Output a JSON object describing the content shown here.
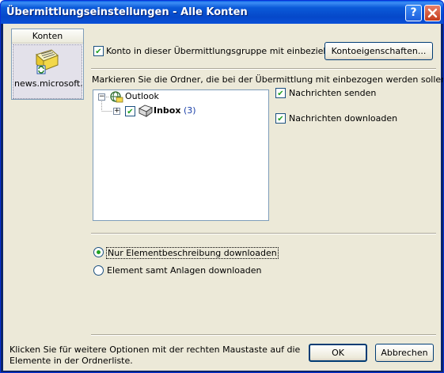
{
  "window": {
    "title": "Übermittlungseinstellungen - Alle Konten",
    "help_label": "?",
    "close_label": "✕"
  },
  "accounts": {
    "header": "Konten",
    "items": [
      {
        "name": "news.microsoft..."
      }
    ]
  },
  "include_account": {
    "label": "Konto in dieser Übermittlungsgruppe mit einbeziehen",
    "checked": true
  },
  "account_properties_button": "Kontoeigenschaften...",
  "folders_instruction": "Markieren Sie die Ordner, die bei der Übermittlung mit einbezogen werden sollen",
  "tree": {
    "root": {
      "label": "Outlook",
      "expander": "−"
    },
    "child": {
      "label": "Inbox",
      "count": "(3)",
      "expander": "+",
      "checked": true
    }
  },
  "options": {
    "send_messages": {
      "label": "Nachrichten senden",
      "checked": true
    },
    "download_messages": {
      "label": "Nachrichten downloaden",
      "checked": true
    }
  },
  "download_mode": {
    "headers_only": {
      "label": "Nur Elementbeschreibung downloaden",
      "selected": true
    },
    "full_items": {
      "label": "Element samt Anlagen downloaden",
      "selected": false
    }
  },
  "footer": {
    "hint_line1": "Klicken Sie für weitere Optionen mit der rechten Maustaste auf die",
    "hint_line2": "Elemente in der Ordnerliste.",
    "ok_label": "OK",
    "cancel_label": "Abbrechen"
  }
}
